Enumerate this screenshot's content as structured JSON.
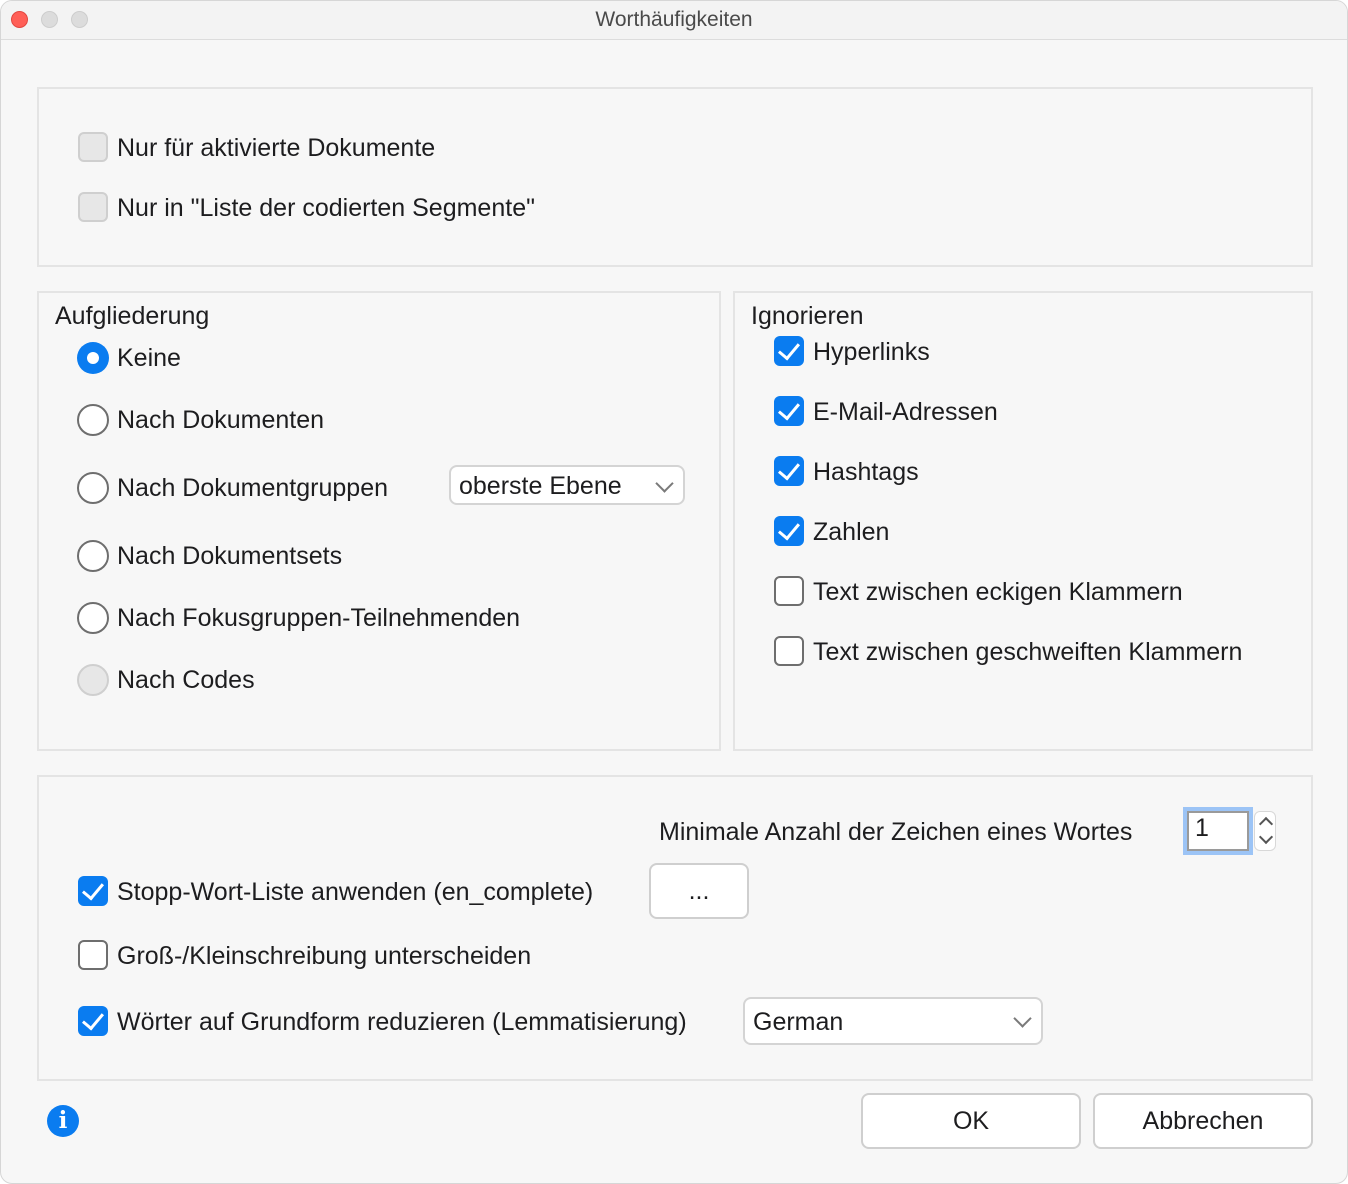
{
  "window": {
    "title": "Worthäufigkeiten"
  },
  "filter": {
    "activated_docs": {
      "label": "Nur für aktivierte Dokumente",
      "checked": false
    },
    "coded_segments": {
      "label": "Nur in \"Liste der codierten Segmente\"",
      "checked": false
    }
  },
  "breakdown": {
    "heading": "Aufgliederung",
    "options": [
      {
        "label": "Keine",
        "selected": true
      },
      {
        "label": "Nach Dokumenten",
        "selected": false
      },
      {
        "label": "Nach Dokumentgruppen",
        "selected": false
      },
      {
        "label": "Nach Dokumentsets",
        "selected": false
      },
      {
        "label": "Nach Fokusgruppen-Teilnehmenden",
        "selected": false
      },
      {
        "label": "Nach Codes",
        "selected": false
      }
    ],
    "group_level_select": "oberste Ebene"
  },
  "ignore": {
    "heading": "Ignorieren",
    "options": [
      {
        "label": "Hyperlinks",
        "checked": true
      },
      {
        "label": "E-Mail-Adressen",
        "checked": true
      },
      {
        "label": "Hashtags",
        "checked": true
      },
      {
        "label": "Zahlen",
        "checked": true
      },
      {
        "label": "Text zwischen eckigen Klammern",
        "checked": false
      },
      {
        "label": "Text zwischen geschweiften Klammern",
        "checked": false
      }
    ]
  },
  "options": {
    "min_chars_label": "Minimale Anzahl der Zeichen eines Wortes",
    "min_chars_value": "1",
    "stopword": {
      "label": "Stopp-Wort-Liste anwenden (en_complete)",
      "checked": true,
      "button": "..."
    },
    "case_sensitive": {
      "label": "Groß-/Kleinschreibung unterscheiden",
      "checked": false
    },
    "lemmatize": {
      "label": "Wörter auf Grundform reduzieren (Lemmatisierung)",
      "checked": true,
      "language": "German"
    }
  },
  "footer": {
    "ok": "OK",
    "cancel": "Abbrechen",
    "info_icon": "i"
  },
  "colors": {
    "accent": "#0a7cf0",
    "window_bg": "#f7f7f7",
    "close": "#ff5f57"
  }
}
